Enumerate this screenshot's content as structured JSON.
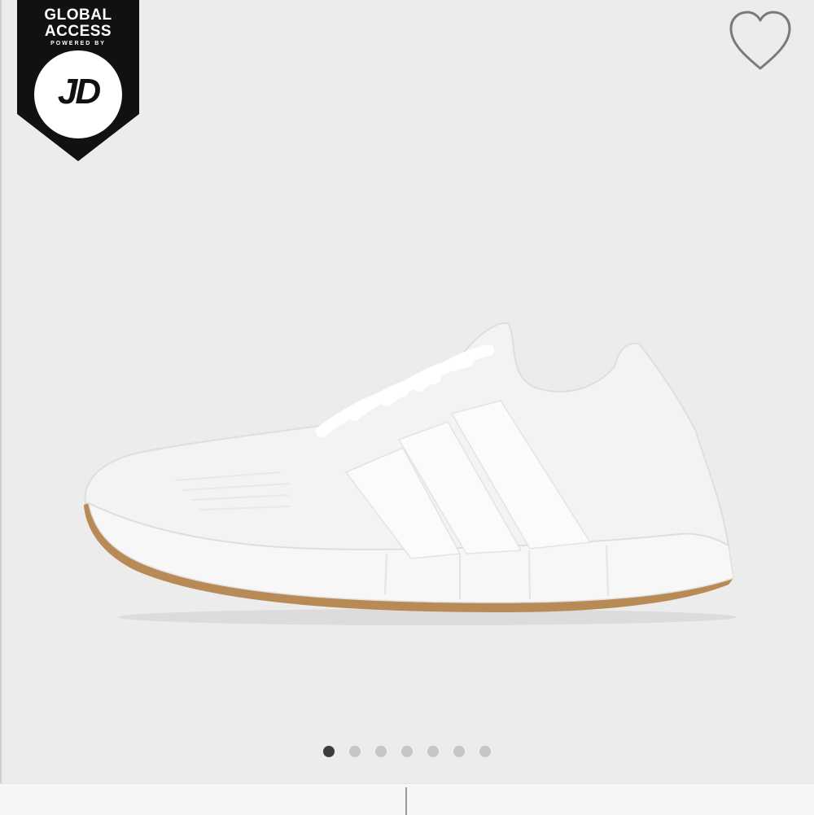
{
  "badge": {
    "line1": "GLOBAL",
    "line2": "ACCESS",
    "line3": "POWERED BY",
    "logo": "JD"
  },
  "wishlist": {
    "icon": "heart-outline-icon"
  },
  "product_image": {
    "subject": "white knit running sneaker with three stripes and gum sole"
  },
  "carousel": {
    "total_images": 7,
    "active_index": 0
  },
  "colors": {
    "background": "#ececec",
    "badge": "#111111",
    "dot_active": "#3d3d3d",
    "dot_inactive": "#c6c6c6",
    "gum_sole": "#b88a55"
  }
}
